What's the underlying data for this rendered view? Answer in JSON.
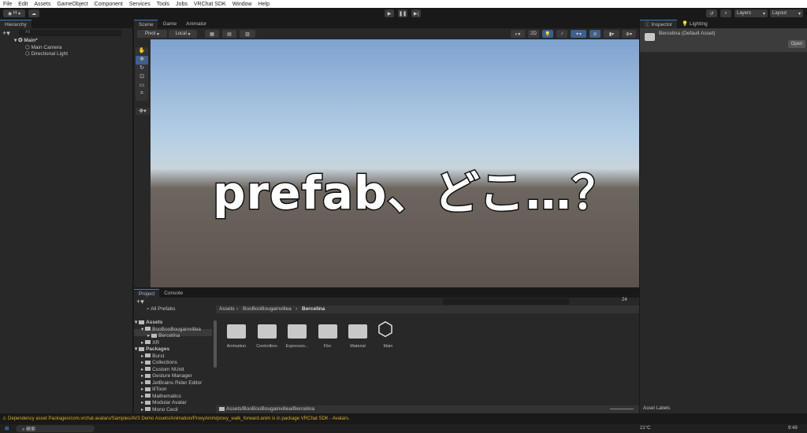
{
  "menu": [
    "File",
    "Edit",
    "Assets",
    "GameObject",
    "Component",
    "Services",
    "Tools",
    "Jobs",
    "VRChat SDK",
    "Window",
    "Help"
  ],
  "toolbar": {
    "account": "H",
    "layers": "Layers",
    "layout": "Layout"
  },
  "hierarchy": {
    "title": "Hierarchy",
    "search_placeholder": "All",
    "scene": "Main*",
    "items": [
      "Main Camera",
      "Directional Light"
    ]
  },
  "scene_tabs": [
    "Scene",
    "Game",
    "Animator"
  ],
  "scene_toolbar": {
    "pivot": "Pivot",
    "local": "Local",
    "mode2d": "2D"
  },
  "caption": "prefab、どこ…？",
  "inspector": {
    "tabs": [
      "Inspector",
      "Lighting"
    ],
    "asset": "Bercelina (Default Asset)",
    "open": "Open",
    "labels": "Asset Labels"
  },
  "project": {
    "tabs": [
      "Project",
      "Console"
    ],
    "all_prefabs": "All Prefabs",
    "tree": [
      {
        "label": "Assets",
        "level": 0
      },
      {
        "label": "BooBooBougainvillea",
        "level": 1
      },
      {
        "label": "Bercelina",
        "level": 2
      },
      {
        "label": "XR",
        "level": 1
      },
      {
        "label": "Packages",
        "level": 0
      },
      {
        "label": "Burst",
        "level": 1
      },
      {
        "label": "Collections",
        "level": 1
      },
      {
        "label": "Custom NUnit",
        "level": 1
      },
      {
        "label": "Gesture Manager",
        "level": 1
      },
      {
        "label": "JetBrains Rider Editor",
        "level": 1
      },
      {
        "label": "lilToon",
        "level": 1
      },
      {
        "label": "Mathematics",
        "level": 1
      },
      {
        "label": "Modular Avatar",
        "level": 1
      },
      {
        "label": "Mono Cecil",
        "level": 1
      }
    ],
    "breadcrumb": [
      "Assets",
      "BooBooBougainvillea",
      "Bercelina"
    ],
    "items": [
      "Animation",
      "Controllers",
      "Expressio...",
      "Fbx",
      "Material",
      "Main"
    ],
    "path": "Assets/BooBooBougainvillea/Bercelina",
    "count": "24"
  },
  "status": "Dependency asset Packages/com.vrchat.avatars/Samples/AV3 Demo Assets/Animation/ProxyAnim/proxy_walk_forward.anim is in package VRChat SDK - Avatars.",
  "taskbar": {
    "search": "検索",
    "weather": "21°C",
    "time": "9:49"
  }
}
